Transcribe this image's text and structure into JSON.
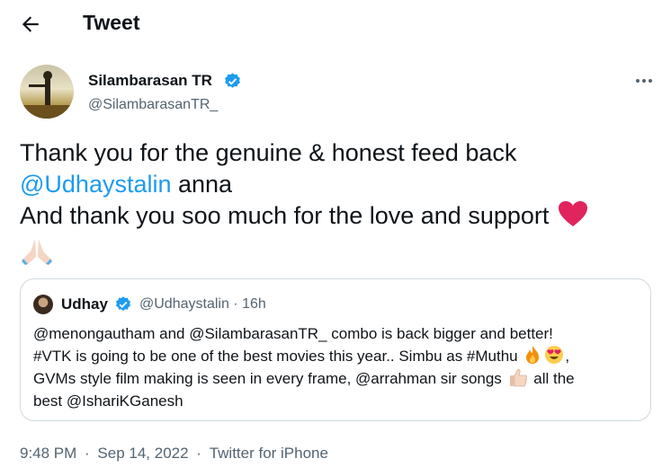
{
  "header": {
    "title": "Tweet"
  },
  "author": {
    "name": "Silambarasan TR",
    "handle": "@SilambarasanTR_"
  },
  "tweet": {
    "line1": "Thank you for the genuine & honest feed back",
    "mention": "@Udhaystalin",
    "line2_suffix": " anna",
    "line3": "And thank you soo much for the love and support"
  },
  "quote": {
    "name": "Udhay",
    "meta": "@Udhaystalin · 16h",
    "line1": "@menongautham and @SilambarasanTR_ combo is back bigger and better!",
    "line2": "#VTK is going to be one of the best movies this year.. Simbu as #Muthu",
    "line2_end": ",",
    "line3": "GVMs style film making is seen in every frame, @arrahman sir songs",
    "line3_end": " all the",
    "line4": "best @IshariKGanesh"
  },
  "footer": {
    "time": "9:48 PM",
    "sep1": " · ",
    "date": "Sep 14, 2022",
    "sep2": " · ",
    "client": "Twitter for iPhone"
  },
  "colors": {
    "link": "#1d9bf0",
    "text": "#0f1419",
    "secondary": "#536471",
    "border": "#cfd9de"
  },
  "icons": [
    "arrow-left-icon",
    "verified-badge-icon",
    "more-icon",
    "red-heart-emoji",
    "folded-hands-emoji",
    "fire-emoji",
    "heart-eyes-emoji",
    "thumbs-up-emoji"
  ]
}
